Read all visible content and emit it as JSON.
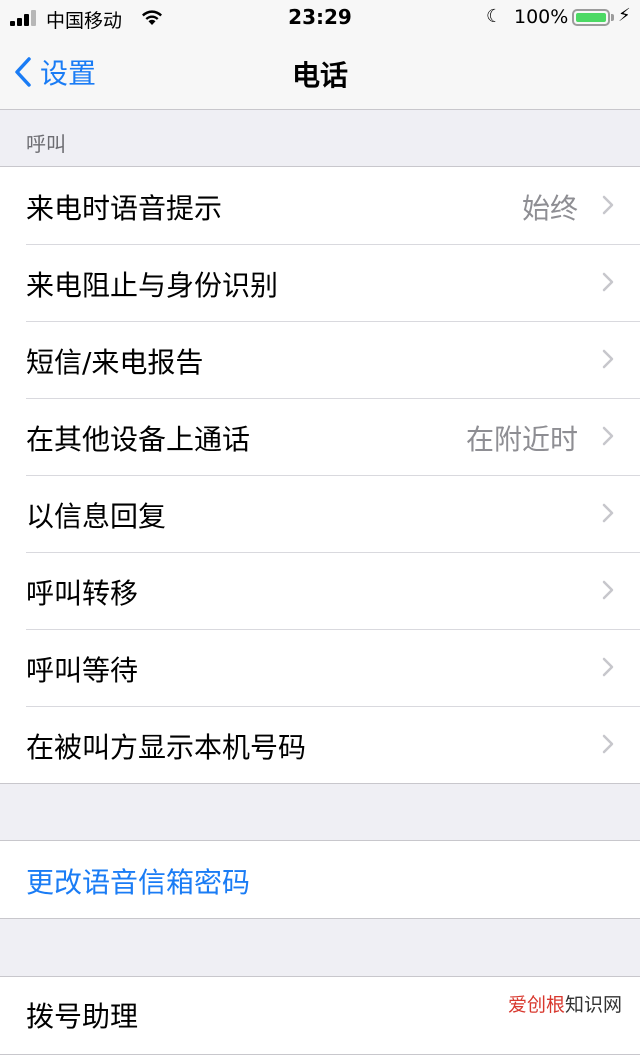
{
  "status": {
    "carrier": "中国移动",
    "time": "23:29",
    "battery": "100%"
  },
  "nav": {
    "back_label": "设置",
    "title": "电话"
  },
  "section_call": {
    "header": "呼叫",
    "rows": [
      {
        "label": "来电时语音提示",
        "value": "始终"
      },
      {
        "label": "来电阻止与身份识别",
        "value": ""
      },
      {
        "label": "短信/来电报告",
        "value": ""
      },
      {
        "label": "在其他设备上通话",
        "value": "在附近时"
      },
      {
        "label": "以信息回复",
        "value": ""
      },
      {
        "label": "呼叫转移",
        "value": ""
      },
      {
        "label": "呼叫等待",
        "value": ""
      },
      {
        "label": "在被叫方显示本机号码",
        "value": ""
      }
    ]
  },
  "voicemail": {
    "label": "更改语音信箱密码"
  },
  "dial_assist": {
    "label": "拨号助理"
  },
  "watermark": {
    "text_red": "爱创根",
    "text": "知识网"
  },
  "colors": {
    "accent": "#1a7cf5",
    "background": "#efeff4",
    "battery": "#4cd964"
  }
}
